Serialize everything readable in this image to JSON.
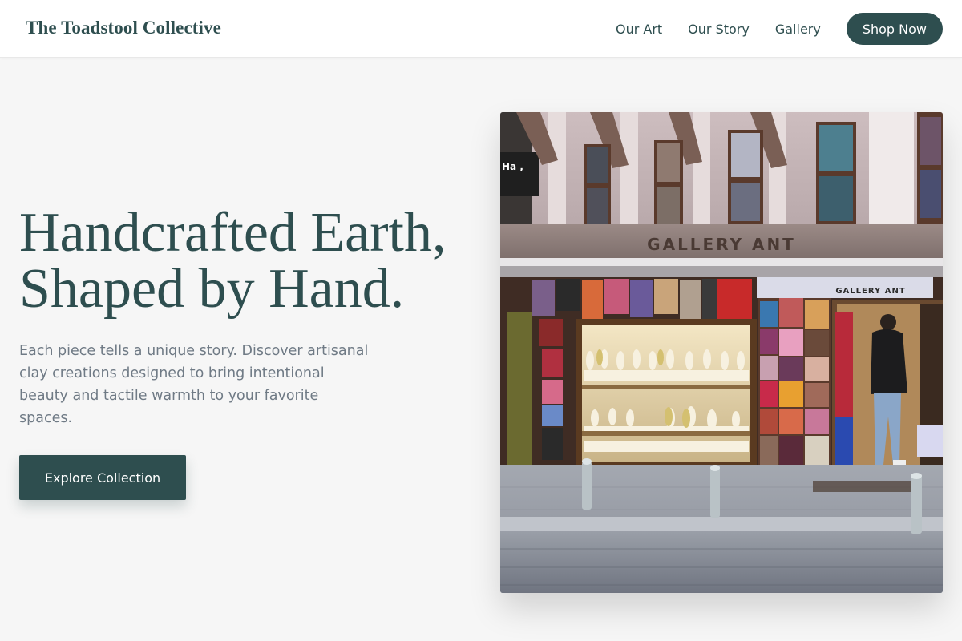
{
  "header": {
    "brand": "The Toadstool Collective",
    "nav": [
      {
        "label": "Our Art"
      },
      {
        "label": "Our Story"
      },
      {
        "label": "Gallery"
      }
    ],
    "cta_label": "Shop Now"
  },
  "hero": {
    "title_lines": [
      "Handcrafted Earth,",
      "Shaped by Hand."
    ],
    "description_lines": [
      "Each piece tells a unique story. Discover artisanal",
      "clay creations designed to bring intentional",
      "beauty and tactile warmth to your favorite",
      "spaces."
    ],
    "button_label": "Explore Collection",
    "image": {
      "storefront_sign": "GALLERY ANT",
      "doorway_sign": "GALLERY ANT",
      "window_sign": "Ha ,"
    }
  },
  "colors": {
    "primary": "#2e4e4f",
    "background": "#f6f6f6",
    "muted_text": "#6f7a85"
  }
}
